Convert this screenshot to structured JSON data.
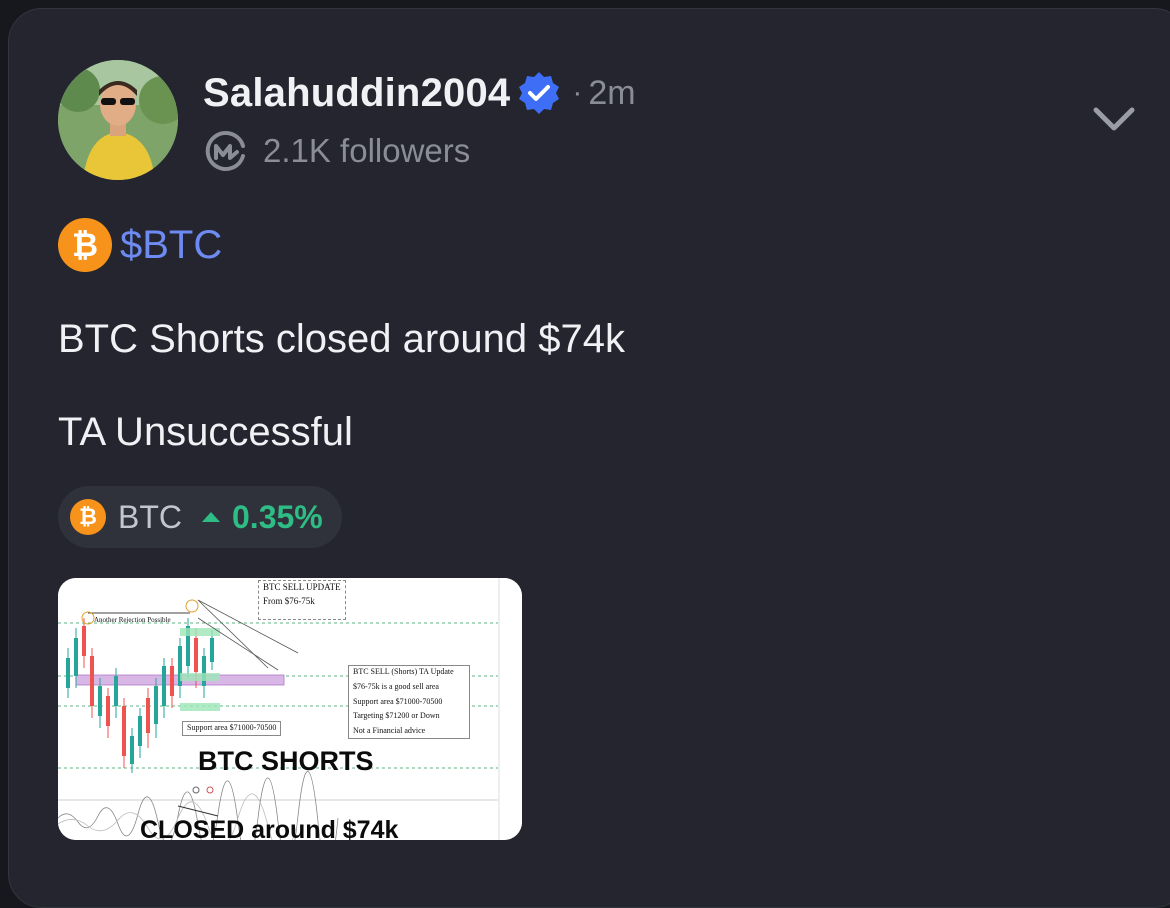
{
  "post": {
    "author": "Salahuddin2004",
    "separator": "·",
    "time": "2m",
    "followers": "2.1K followers",
    "tag": "$BTC",
    "coin_glyph": "₿",
    "lines": [
      "BTC Shorts closed around $74k",
      "TA Unsuccessful"
    ]
  },
  "ticker": {
    "symbol": "BTC",
    "change": "0.35%",
    "direction": "up",
    "change_color": "#2ebd85"
  },
  "image": {
    "box1_title": "BTC SELL UPDATE",
    "box1_sub": "From $76-75k",
    "rejection": "Another Rejection Possible",
    "support": "Support area $71000-70500",
    "ta_lines": [
      "BTC SELL (Shorts) TA Update",
      "$76-75k is a good sell area",
      "Support area $71000-70500",
      "Targeting $71200 or Down",
      "Not a Financial advice"
    ],
    "headline1": "BTC SHORTS",
    "headline2": "CLOSED around $74k"
  },
  "icons": {
    "verified": "verified-badge-icon",
    "community": "coinmarketcap-logo-icon",
    "menu": "chevron-down-icon",
    "coin": "bitcoin-coin-icon"
  },
  "colors": {
    "background": "#24252e",
    "tag": "#6d8bf2",
    "bitcoin": "#f7931a",
    "verified": "#3d6ef5"
  }
}
